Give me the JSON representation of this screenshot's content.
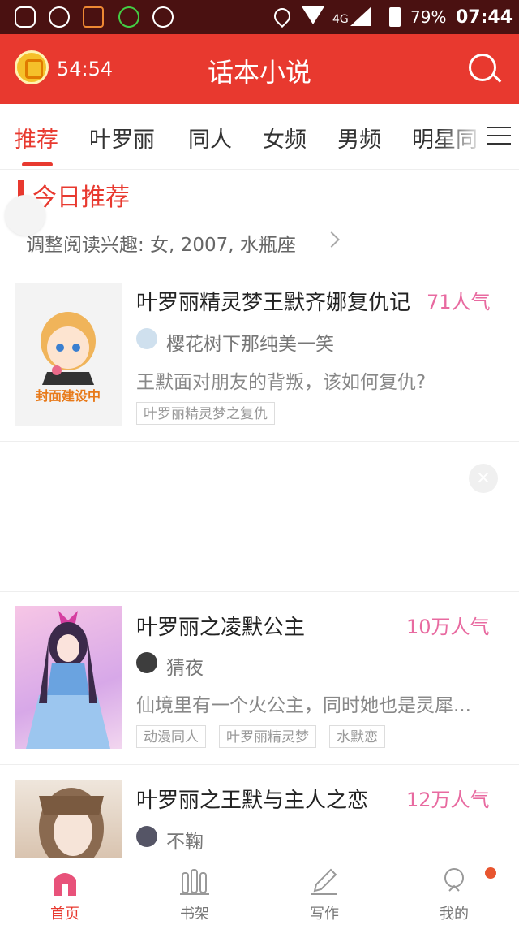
{
  "status_bar": {
    "battery": "79%",
    "time": "07:44",
    "network": "4G"
  },
  "header": {
    "timer": "54:54",
    "title": "话本小说"
  },
  "tabs": [
    {
      "label": "推荐",
      "active": true
    },
    {
      "label": "叶罗丽"
    },
    {
      "label": "同人"
    },
    {
      "label": "女频"
    },
    {
      "label": "男频"
    },
    {
      "label": "明星同"
    }
  ],
  "section": {
    "title": "今日推荐",
    "interest": "调整阅读兴趣: 女, 2007, 水瓶座"
  },
  "books": [
    {
      "cover_text": "封面建设中",
      "title": "叶罗丽精灵梦王默齐娜复仇记",
      "popularity": "71人气",
      "author": "樱花树下那纯美一笑",
      "desc": "王默面对朋友的背叛，该如何复仇?",
      "tags": [
        "叶罗丽精灵梦之复仇"
      ]
    },
    {
      "title": "叶罗丽之凌默公主",
      "popularity": "10万人气",
      "author": "猜夜",
      "desc": "仙境里有一个火公主，同时她也是灵犀...",
      "tags": [
        "动漫同人",
        "叶罗丽精灵梦",
        "水默恋"
      ]
    },
    {
      "title": "叶罗丽之王默与主人之恋",
      "popularity": "12万人气",
      "author": "不鞠"
    }
  ],
  "nav": [
    {
      "label": "首页",
      "icon": "home-icon",
      "active": true
    },
    {
      "label": "书架",
      "icon": "bookshelf-icon"
    },
    {
      "label": "写作",
      "icon": "pen-icon"
    },
    {
      "label": "我的",
      "icon": "profile-icon"
    }
  ],
  "colors": {
    "brand": "#e8392f",
    "popularity": "#e86aa0"
  }
}
